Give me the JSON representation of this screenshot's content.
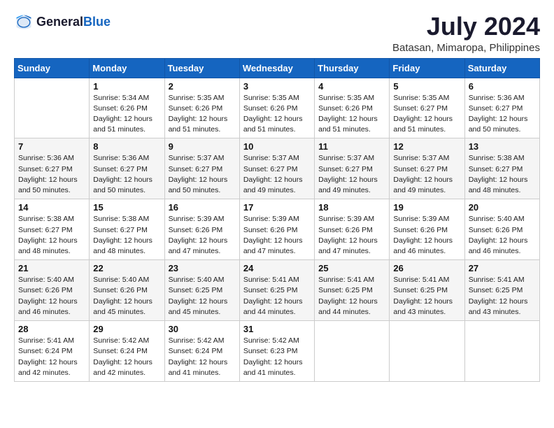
{
  "header": {
    "logo_general": "General",
    "logo_blue": "Blue",
    "title": "July 2024",
    "subtitle": "Batasan, Mimaropa, Philippines"
  },
  "days_of_week": [
    "Sunday",
    "Monday",
    "Tuesday",
    "Wednesday",
    "Thursday",
    "Friday",
    "Saturday"
  ],
  "weeks": [
    [
      {
        "day": "",
        "info": ""
      },
      {
        "day": "1",
        "info": "Sunrise: 5:34 AM\nSunset: 6:26 PM\nDaylight: 12 hours\nand 51 minutes."
      },
      {
        "day": "2",
        "info": "Sunrise: 5:35 AM\nSunset: 6:26 PM\nDaylight: 12 hours\nand 51 minutes."
      },
      {
        "day": "3",
        "info": "Sunrise: 5:35 AM\nSunset: 6:26 PM\nDaylight: 12 hours\nand 51 minutes."
      },
      {
        "day": "4",
        "info": "Sunrise: 5:35 AM\nSunset: 6:26 PM\nDaylight: 12 hours\nand 51 minutes."
      },
      {
        "day": "5",
        "info": "Sunrise: 5:35 AM\nSunset: 6:27 PM\nDaylight: 12 hours\nand 51 minutes."
      },
      {
        "day": "6",
        "info": "Sunrise: 5:36 AM\nSunset: 6:27 PM\nDaylight: 12 hours\nand 50 minutes."
      }
    ],
    [
      {
        "day": "7",
        "info": "Sunrise: 5:36 AM\nSunset: 6:27 PM\nDaylight: 12 hours\nand 50 minutes."
      },
      {
        "day": "8",
        "info": "Sunrise: 5:36 AM\nSunset: 6:27 PM\nDaylight: 12 hours\nand 50 minutes."
      },
      {
        "day": "9",
        "info": "Sunrise: 5:37 AM\nSunset: 6:27 PM\nDaylight: 12 hours\nand 50 minutes."
      },
      {
        "day": "10",
        "info": "Sunrise: 5:37 AM\nSunset: 6:27 PM\nDaylight: 12 hours\nand 49 minutes."
      },
      {
        "day": "11",
        "info": "Sunrise: 5:37 AM\nSunset: 6:27 PM\nDaylight: 12 hours\nand 49 minutes."
      },
      {
        "day": "12",
        "info": "Sunrise: 5:37 AM\nSunset: 6:27 PM\nDaylight: 12 hours\nand 49 minutes."
      },
      {
        "day": "13",
        "info": "Sunrise: 5:38 AM\nSunset: 6:27 PM\nDaylight: 12 hours\nand 48 minutes."
      }
    ],
    [
      {
        "day": "14",
        "info": "Sunrise: 5:38 AM\nSunset: 6:27 PM\nDaylight: 12 hours\nand 48 minutes."
      },
      {
        "day": "15",
        "info": "Sunrise: 5:38 AM\nSunset: 6:27 PM\nDaylight: 12 hours\nand 48 minutes."
      },
      {
        "day": "16",
        "info": "Sunrise: 5:39 AM\nSunset: 6:26 PM\nDaylight: 12 hours\nand 47 minutes."
      },
      {
        "day": "17",
        "info": "Sunrise: 5:39 AM\nSunset: 6:26 PM\nDaylight: 12 hours\nand 47 minutes."
      },
      {
        "day": "18",
        "info": "Sunrise: 5:39 AM\nSunset: 6:26 PM\nDaylight: 12 hours\nand 47 minutes."
      },
      {
        "day": "19",
        "info": "Sunrise: 5:39 AM\nSunset: 6:26 PM\nDaylight: 12 hours\nand 46 minutes."
      },
      {
        "day": "20",
        "info": "Sunrise: 5:40 AM\nSunset: 6:26 PM\nDaylight: 12 hours\nand 46 minutes."
      }
    ],
    [
      {
        "day": "21",
        "info": "Sunrise: 5:40 AM\nSunset: 6:26 PM\nDaylight: 12 hours\nand 46 minutes."
      },
      {
        "day": "22",
        "info": "Sunrise: 5:40 AM\nSunset: 6:26 PM\nDaylight: 12 hours\nand 45 minutes."
      },
      {
        "day": "23",
        "info": "Sunrise: 5:40 AM\nSunset: 6:25 PM\nDaylight: 12 hours\nand 45 minutes."
      },
      {
        "day": "24",
        "info": "Sunrise: 5:41 AM\nSunset: 6:25 PM\nDaylight: 12 hours\nand 44 minutes."
      },
      {
        "day": "25",
        "info": "Sunrise: 5:41 AM\nSunset: 6:25 PM\nDaylight: 12 hours\nand 44 minutes."
      },
      {
        "day": "26",
        "info": "Sunrise: 5:41 AM\nSunset: 6:25 PM\nDaylight: 12 hours\nand 43 minutes."
      },
      {
        "day": "27",
        "info": "Sunrise: 5:41 AM\nSunset: 6:25 PM\nDaylight: 12 hours\nand 43 minutes."
      }
    ],
    [
      {
        "day": "28",
        "info": "Sunrise: 5:41 AM\nSunset: 6:24 PM\nDaylight: 12 hours\nand 42 minutes."
      },
      {
        "day": "29",
        "info": "Sunrise: 5:42 AM\nSunset: 6:24 PM\nDaylight: 12 hours\nand 42 minutes."
      },
      {
        "day": "30",
        "info": "Sunrise: 5:42 AM\nSunset: 6:24 PM\nDaylight: 12 hours\nand 41 minutes."
      },
      {
        "day": "31",
        "info": "Sunrise: 5:42 AM\nSunset: 6:23 PM\nDaylight: 12 hours\nand 41 minutes."
      },
      {
        "day": "",
        "info": ""
      },
      {
        "day": "",
        "info": ""
      },
      {
        "day": "",
        "info": ""
      }
    ]
  ]
}
